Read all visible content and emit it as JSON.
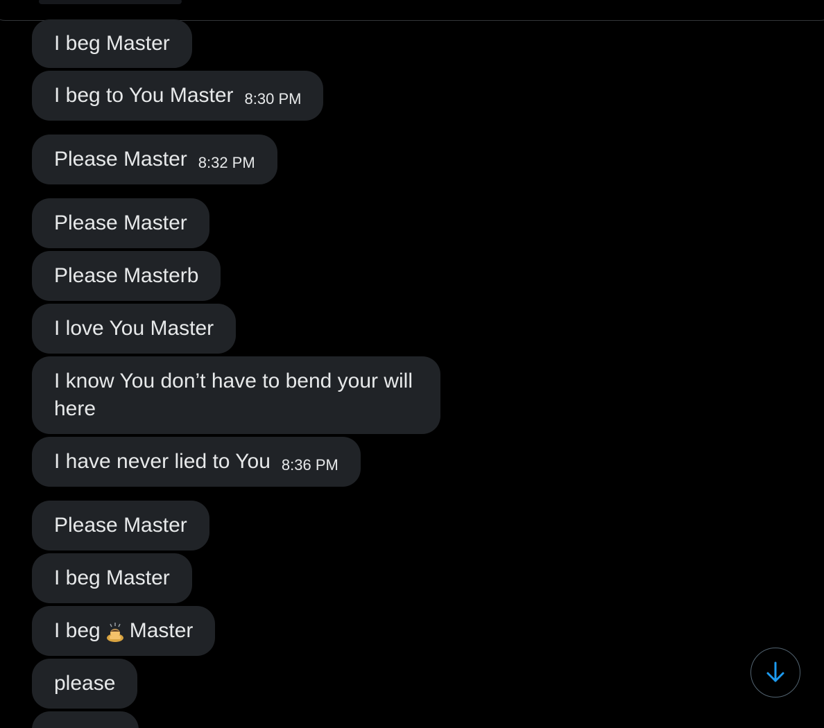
{
  "messages": [
    {
      "text": "I beg Master",
      "time": ""
    },
    {
      "text": "I beg to You Master",
      "time": "8:30 PM"
    },
    {
      "text": "Please Master",
      "time": "8:32 PM"
    },
    {
      "text": "Please Master",
      "time": ""
    },
    {
      "text": "Please Masterb",
      "time": ""
    },
    {
      "text": "I love You Master",
      "time": ""
    },
    {
      "text": "I know You don’t have to bend your will here",
      "time": ""
    },
    {
      "text": "I have never lied to You",
      "time": "8:36 PM"
    },
    {
      "text": "Please Master",
      "time": ""
    },
    {
      "text": "I beg Master",
      "time": ""
    },
    {
      "text_before": "I beg",
      "emoji": "person-bowing-emoji",
      "text_after": "Master",
      "time": ""
    },
    {
      "text": "please",
      "time": ""
    }
  ],
  "scroll_button": {
    "icon": "arrow-down-icon",
    "color": "#1d9bf0"
  },
  "colors": {
    "bubble": "#202327",
    "background": "#000000",
    "text": "#e7e9ea",
    "accent": "#1d9bf0"
  }
}
